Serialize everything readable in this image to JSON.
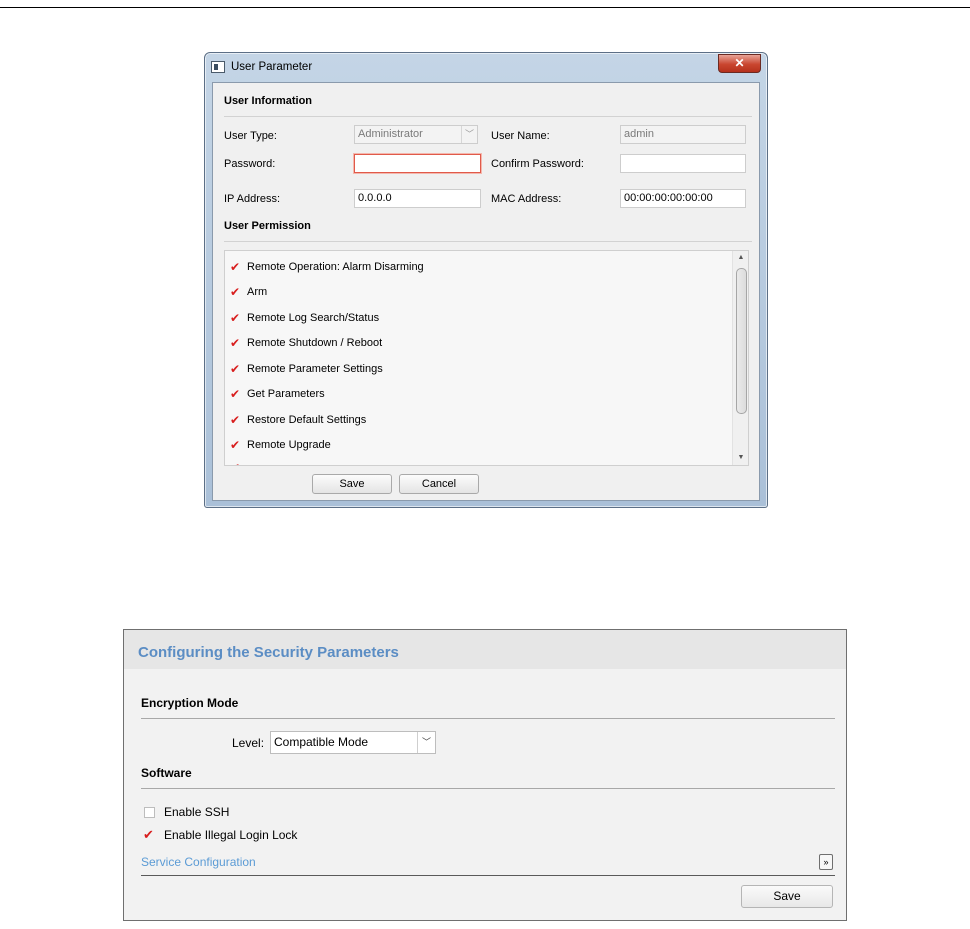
{
  "dialog": {
    "title": "User Parameter",
    "close_symbol": "✕",
    "user_information": {
      "heading": "User Information",
      "user_type_label": "User Type:",
      "user_type_value": "Administrator",
      "user_name_label": "User Name:",
      "user_name_value": "admin",
      "password_label": "Password:",
      "password_value": "",
      "confirm_password_label": "Confirm Password:",
      "confirm_password_value": "",
      "ip_address_label": "IP Address:",
      "ip_address_value": "0.0.0.0",
      "mac_address_label": "MAC Address:",
      "mac_address_value": "00:00:00:00:00:00"
    },
    "user_permission": {
      "heading": "User Permission",
      "items": [
        {
          "label": "Remote Operation: Alarm Disarming",
          "checked": true
        },
        {
          "label": "Arm",
          "checked": true
        },
        {
          "label": "Remote Log Search/Status",
          "checked": true
        },
        {
          "label": "Remote Shutdown / Reboot",
          "checked": true
        },
        {
          "label": "Remote Parameter Settings",
          "checked": true
        },
        {
          "label": "Get Parameters",
          "checked": true
        },
        {
          "label": "Restore Default Settings",
          "checked": true
        },
        {
          "label": "Remote Upgrade",
          "checked": true
        }
      ]
    },
    "save_label": "Save",
    "cancel_label": "Cancel"
  },
  "security": {
    "title": "Configuring the Security Parameters",
    "encryption_heading": "Encryption Mode",
    "level_label": "Level:",
    "level_value": "Compatible Mode",
    "software_heading": "Software",
    "enable_ssh_label": "Enable SSH",
    "enable_ssh_checked": false,
    "illegal_login_label": "Enable Illegal Login Lock",
    "illegal_login_checked": true,
    "service_config_label": "Service Configuration",
    "save_label": "Save"
  },
  "colors": {
    "checkmark": "#d81e1e",
    "link": "#5b9bd5",
    "panel_title": "#5b8dc4",
    "close_button": "#c9462f"
  }
}
